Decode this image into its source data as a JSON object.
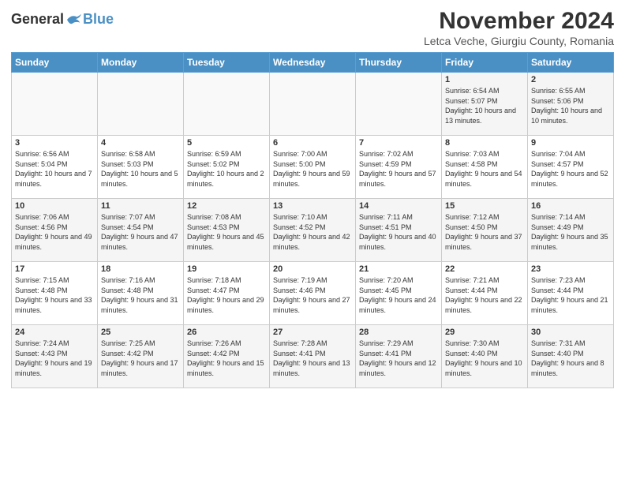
{
  "logo": {
    "general": "General",
    "blue": "Blue"
  },
  "title": "November 2024",
  "subtitle": "Letca Veche, Giurgiu County, Romania",
  "headers": [
    "Sunday",
    "Monday",
    "Tuesday",
    "Wednesday",
    "Thursday",
    "Friday",
    "Saturday"
  ],
  "weeks": [
    [
      {
        "day": "",
        "info": ""
      },
      {
        "day": "",
        "info": ""
      },
      {
        "day": "",
        "info": ""
      },
      {
        "day": "",
        "info": ""
      },
      {
        "day": "",
        "info": ""
      },
      {
        "day": "1",
        "info": "Sunrise: 6:54 AM\nSunset: 5:07 PM\nDaylight: 10 hours and 13 minutes."
      },
      {
        "day": "2",
        "info": "Sunrise: 6:55 AM\nSunset: 5:06 PM\nDaylight: 10 hours and 10 minutes."
      }
    ],
    [
      {
        "day": "3",
        "info": "Sunrise: 6:56 AM\nSunset: 5:04 PM\nDaylight: 10 hours and 7 minutes."
      },
      {
        "day": "4",
        "info": "Sunrise: 6:58 AM\nSunset: 5:03 PM\nDaylight: 10 hours and 5 minutes."
      },
      {
        "day": "5",
        "info": "Sunrise: 6:59 AM\nSunset: 5:02 PM\nDaylight: 10 hours and 2 minutes."
      },
      {
        "day": "6",
        "info": "Sunrise: 7:00 AM\nSunset: 5:00 PM\nDaylight: 9 hours and 59 minutes."
      },
      {
        "day": "7",
        "info": "Sunrise: 7:02 AM\nSunset: 4:59 PM\nDaylight: 9 hours and 57 minutes."
      },
      {
        "day": "8",
        "info": "Sunrise: 7:03 AM\nSunset: 4:58 PM\nDaylight: 9 hours and 54 minutes."
      },
      {
        "day": "9",
        "info": "Sunrise: 7:04 AM\nSunset: 4:57 PM\nDaylight: 9 hours and 52 minutes."
      }
    ],
    [
      {
        "day": "10",
        "info": "Sunrise: 7:06 AM\nSunset: 4:56 PM\nDaylight: 9 hours and 49 minutes."
      },
      {
        "day": "11",
        "info": "Sunrise: 7:07 AM\nSunset: 4:54 PM\nDaylight: 9 hours and 47 minutes."
      },
      {
        "day": "12",
        "info": "Sunrise: 7:08 AM\nSunset: 4:53 PM\nDaylight: 9 hours and 45 minutes."
      },
      {
        "day": "13",
        "info": "Sunrise: 7:10 AM\nSunset: 4:52 PM\nDaylight: 9 hours and 42 minutes."
      },
      {
        "day": "14",
        "info": "Sunrise: 7:11 AM\nSunset: 4:51 PM\nDaylight: 9 hours and 40 minutes."
      },
      {
        "day": "15",
        "info": "Sunrise: 7:12 AM\nSunset: 4:50 PM\nDaylight: 9 hours and 37 minutes."
      },
      {
        "day": "16",
        "info": "Sunrise: 7:14 AM\nSunset: 4:49 PM\nDaylight: 9 hours and 35 minutes."
      }
    ],
    [
      {
        "day": "17",
        "info": "Sunrise: 7:15 AM\nSunset: 4:48 PM\nDaylight: 9 hours and 33 minutes."
      },
      {
        "day": "18",
        "info": "Sunrise: 7:16 AM\nSunset: 4:48 PM\nDaylight: 9 hours and 31 minutes."
      },
      {
        "day": "19",
        "info": "Sunrise: 7:18 AM\nSunset: 4:47 PM\nDaylight: 9 hours and 29 minutes."
      },
      {
        "day": "20",
        "info": "Sunrise: 7:19 AM\nSunset: 4:46 PM\nDaylight: 9 hours and 27 minutes."
      },
      {
        "day": "21",
        "info": "Sunrise: 7:20 AM\nSunset: 4:45 PM\nDaylight: 9 hours and 24 minutes."
      },
      {
        "day": "22",
        "info": "Sunrise: 7:21 AM\nSunset: 4:44 PM\nDaylight: 9 hours and 22 minutes."
      },
      {
        "day": "23",
        "info": "Sunrise: 7:23 AM\nSunset: 4:44 PM\nDaylight: 9 hours and 21 minutes."
      }
    ],
    [
      {
        "day": "24",
        "info": "Sunrise: 7:24 AM\nSunset: 4:43 PM\nDaylight: 9 hours and 19 minutes."
      },
      {
        "day": "25",
        "info": "Sunrise: 7:25 AM\nSunset: 4:42 PM\nDaylight: 9 hours and 17 minutes."
      },
      {
        "day": "26",
        "info": "Sunrise: 7:26 AM\nSunset: 4:42 PM\nDaylight: 9 hours and 15 minutes."
      },
      {
        "day": "27",
        "info": "Sunrise: 7:28 AM\nSunset: 4:41 PM\nDaylight: 9 hours and 13 minutes."
      },
      {
        "day": "28",
        "info": "Sunrise: 7:29 AM\nSunset: 4:41 PM\nDaylight: 9 hours and 12 minutes."
      },
      {
        "day": "29",
        "info": "Sunrise: 7:30 AM\nSunset: 4:40 PM\nDaylight: 9 hours and 10 minutes."
      },
      {
        "day": "30",
        "info": "Sunrise: 7:31 AM\nSunset: 4:40 PM\nDaylight: 9 hours and 8 minutes."
      }
    ]
  ]
}
